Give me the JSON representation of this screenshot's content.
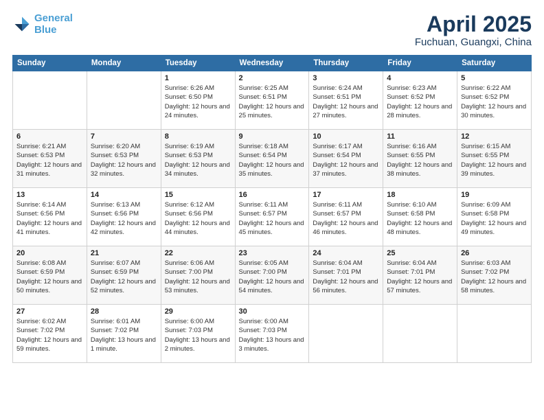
{
  "logo": {
    "line1": "General",
    "line2": "Blue"
  },
  "title": "April 2025",
  "subtitle": "Fuchuan, Guangxi, China",
  "days_of_week": [
    "Sunday",
    "Monday",
    "Tuesday",
    "Wednesday",
    "Thursday",
    "Friday",
    "Saturday"
  ],
  "weeks": [
    [
      {
        "day": "",
        "info": ""
      },
      {
        "day": "",
        "info": ""
      },
      {
        "day": "1",
        "info": "Sunrise: 6:26 AM\nSunset: 6:50 PM\nDaylight: 12 hours and 24 minutes."
      },
      {
        "day": "2",
        "info": "Sunrise: 6:25 AM\nSunset: 6:51 PM\nDaylight: 12 hours and 25 minutes."
      },
      {
        "day": "3",
        "info": "Sunrise: 6:24 AM\nSunset: 6:51 PM\nDaylight: 12 hours and 27 minutes."
      },
      {
        "day": "4",
        "info": "Sunrise: 6:23 AM\nSunset: 6:52 PM\nDaylight: 12 hours and 28 minutes."
      },
      {
        "day": "5",
        "info": "Sunrise: 6:22 AM\nSunset: 6:52 PM\nDaylight: 12 hours and 30 minutes."
      }
    ],
    [
      {
        "day": "6",
        "info": "Sunrise: 6:21 AM\nSunset: 6:53 PM\nDaylight: 12 hours and 31 minutes."
      },
      {
        "day": "7",
        "info": "Sunrise: 6:20 AM\nSunset: 6:53 PM\nDaylight: 12 hours and 32 minutes."
      },
      {
        "day": "8",
        "info": "Sunrise: 6:19 AM\nSunset: 6:53 PM\nDaylight: 12 hours and 34 minutes."
      },
      {
        "day": "9",
        "info": "Sunrise: 6:18 AM\nSunset: 6:54 PM\nDaylight: 12 hours and 35 minutes."
      },
      {
        "day": "10",
        "info": "Sunrise: 6:17 AM\nSunset: 6:54 PM\nDaylight: 12 hours and 37 minutes."
      },
      {
        "day": "11",
        "info": "Sunrise: 6:16 AM\nSunset: 6:55 PM\nDaylight: 12 hours and 38 minutes."
      },
      {
        "day": "12",
        "info": "Sunrise: 6:15 AM\nSunset: 6:55 PM\nDaylight: 12 hours and 39 minutes."
      }
    ],
    [
      {
        "day": "13",
        "info": "Sunrise: 6:14 AM\nSunset: 6:56 PM\nDaylight: 12 hours and 41 minutes."
      },
      {
        "day": "14",
        "info": "Sunrise: 6:13 AM\nSunset: 6:56 PM\nDaylight: 12 hours and 42 minutes."
      },
      {
        "day": "15",
        "info": "Sunrise: 6:12 AM\nSunset: 6:56 PM\nDaylight: 12 hours and 44 minutes."
      },
      {
        "day": "16",
        "info": "Sunrise: 6:11 AM\nSunset: 6:57 PM\nDaylight: 12 hours and 45 minutes."
      },
      {
        "day": "17",
        "info": "Sunrise: 6:11 AM\nSunset: 6:57 PM\nDaylight: 12 hours and 46 minutes."
      },
      {
        "day": "18",
        "info": "Sunrise: 6:10 AM\nSunset: 6:58 PM\nDaylight: 12 hours and 48 minutes."
      },
      {
        "day": "19",
        "info": "Sunrise: 6:09 AM\nSunset: 6:58 PM\nDaylight: 12 hours and 49 minutes."
      }
    ],
    [
      {
        "day": "20",
        "info": "Sunrise: 6:08 AM\nSunset: 6:59 PM\nDaylight: 12 hours and 50 minutes."
      },
      {
        "day": "21",
        "info": "Sunrise: 6:07 AM\nSunset: 6:59 PM\nDaylight: 12 hours and 52 minutes."
      },
      {
        "day": "22",
        "info": "Sunrise: 6:06 AM\nSunset: 7:00 PM\nDaylight: 12 hours and 53 minutes."
      },
      {
        "day": "23",
        "info": "Sunrise: 6:05 AM\nSunset: 7:00 PM\nDaylight: 12 hours and 54 minutes."
      },
      {
        "day": "24",
        "info": "Sunrise: 6:04 AM\nSunset: 7:01 PM\nDaylight: 12 hours and 56 minutes."
      },
      {
        "day": "25",
        "info": "Sunrise: 6:04 AM\nSunset: 7:01 PM\nDaylight: 12 hours and 57 minutes."
      },
      {
        "day": "26",
        "info": "Sunrise: 6:03 AM\nSunset: 7:02 PM\nDaylight: 12 hours and 58 minutes."
      }
    ],
    [
      {
        "day": "27",
        "info": "Sunrise: 6:02 AM\nSunset: 7:02 PM\nDaylight: 12 hours and 59 minutes."
      },
      {
        "day": "28",
        "info": "Sunrise: 6:01 AM\nSunset: 7:02 PM\nDaylight: 13 hours and 1 minute."
      },
      {
        "day": "29",
        "info": "Sunrise: 6:00 AM\nSunset: 7:03 PM\nDaylight: 13 hours and 2 minutes."
      },
      {
        "day": "30",
        "info": "Sunrise: 6:00 AM\nSunset: 7:03 PM\nDaylight: 13 hours and 3 minutes."
      },
      {
        "day": "",
        "info": ""
      },
      {
        "day": "",
        "info": ""
      },
      {
        "day": "",
        "info": ""
      }
    ]
  ]
}
